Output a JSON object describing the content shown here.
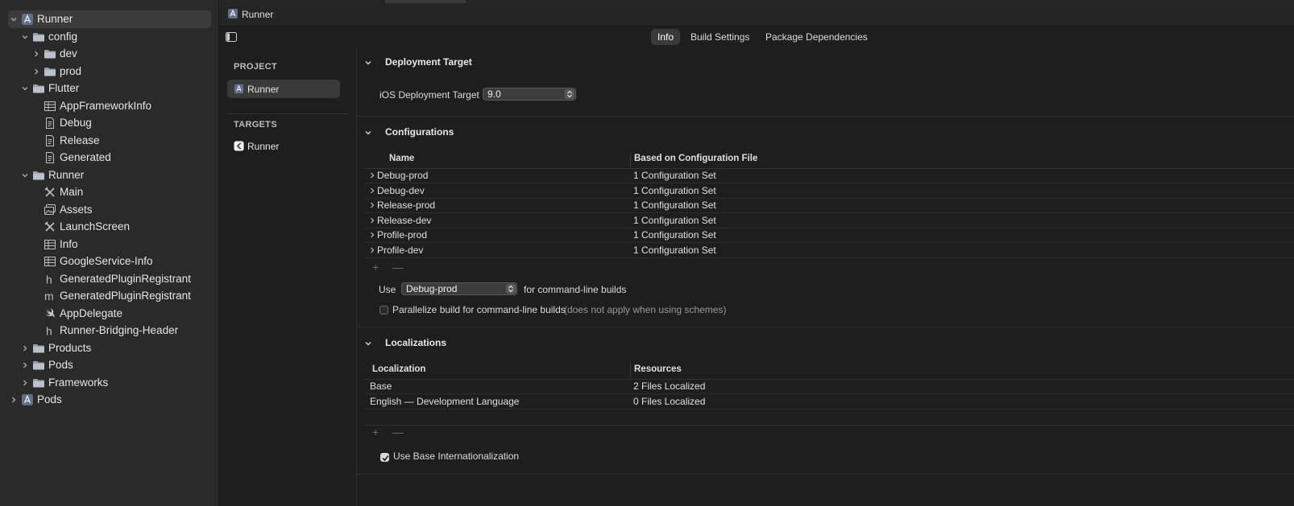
{
  "navigator": {
    "items": [
      {
        "label": "Runner",
        "icon": "xcode-project-icon",
        "disclosure": "expanded"
      },
      {
        "label": "config",
        "icon": "folder-icon",
        "disclosure": "expanded"
      },
      {
        "label": "dev",
        "icon": "folder-icon",
        "disclosure": "collapsed"
      },
      {
        "label": "prod",
        "icon": "folder-icon",
        "disclosure": "collapsed"
      },
      {
        "label": "Flutter",
        "icon": "folder-icon",
        "disclosure": "expanded"
      },
      {
        "label": "AppFrameworkInfo",
        "icon": "plist-icon"
      },
      {
        "label": "Debug",
        "icon": "xcconfig-icon"
      },
      {
        "label": "Release",
        "icon": "xcconfig-icon"
      },
      {
        "label": "Generated",
        "icon": "xcconfig-icon"
      },
      {
        "label": "Runner",
        "icon": "folder-icon",
        "disclosure": "expanded"
      },
      {
        "label": "Main",
        "icon": "storyboard-icon"
      },
      {
        "label": "Assets",
        "icon": "assets-icon"
      },
      {
        "label": "LaunchScreen",
        "icon": "storyboard-icon"
      },
      {
        "label": "Info",
        "icon": "plist-icon"
      },
      {
        "label": "GoogleService-Info",
        "icon": "plist-icon"
      },
      {
        "label": "GeneratedPluginRegistrant",
        "icon": "header-h-icon"
      },
      {
        "label": "GeneratedPluginRegistrant",
        "icon": "source-m-icon"
      },
      {
        "label": "AppDelegate",
        "icon": "swift-icon"
      },
      {
        "label": "Runner-Bridging-Header",
        "icon": "header-h-icon"
      },
      {
        "label": "Products",
        "icon": "folder-icon",
        "disclosure": "collapsed"
      },
      {
        "label": "Pods",
        "icon": "folder-icon",
        "disclosure": "collapsed"
      },
      {
        "label": "Frameworks",
        "icon": "folder-icon",
        "disclosure": "collapsed"
      },
      {
        "label": "Pods",
        "icon": "xcode-project-icon",
        "disclosure": "collapsed"
      }
    ]
  },
  "breadcrumb": {
    "label": "Runner"
  },
  "tabs": [
    {
      "label": "Info",
      "active": true
    },
    {
      "label": "Build Settings",
      "active": false
    },
    {
      "label": "Package Dependencies",
      "active": false
    }
  ],
  "targets_panel": {
    "project_header": "PROJECT",
    "project_item": "Runner",
    "targets_header": "TARGETS",
    "target_item": "Runner"
  },
  "deployment": {
    "title": "Deployment Target",
    "label": "iOS Deployment Target",
    "value": "9.0"
  },
  "configurations": {
    "title": "Configurations",
    "col_name": "Name",
    "col_based": "Based on Configuration File",
    "rows": [
      {
        "name": "Debug-prod",
        "based": "1 Configuration Set"
      },
      {
        "name": "Debug-dev",
        "based": "1 Configuration Set"
      },
      {
        "name": "Release-prod",
        "based": "1 Configuration Set"
      },
      {
        "name": "Release-dev",
        "based": "1 Configuration Set"
      },
      {
        "name": "Profile-prod",
        "based": "1 Configuration Set"
      },
      {
        "name": "Profile-dev",
        "based": "1 Configuration Set"
      }
    ],
    "add_symbol": "+",
    "remove_symbol": "—",
    "use_label": "Use",
    "use_value": "Debug-prod",
    "use_suffix": "for command-line builds",
    "parallelize_label": "Parallelize build for command-line builds",
    "parallelize_note": "(does not apply when using schemes)",
    "parallelize_checked": false
  },
  "localizations": {
    "title": "Localizations",
    "col_loc": "Localization",
    "col_res": "Resources",
    "rows": [
      {
        "loc": "Base",
        "res": "2 Files Localized"
      },
      {
        "loc": "English — Development Language",
        "res": "0 Files Localized"
      }
    ],
    "add_symbol": "+",
    "remove_symbol": "—",
    "base_intl_label": "Use Base Internationalization",
    "base_intl_checked": true
  },
  "colors": {
    "background": "#1e1e1e",
    "sidebar": "#2a2a2a",
    "selection": "#3b3b3b"
  }
}
